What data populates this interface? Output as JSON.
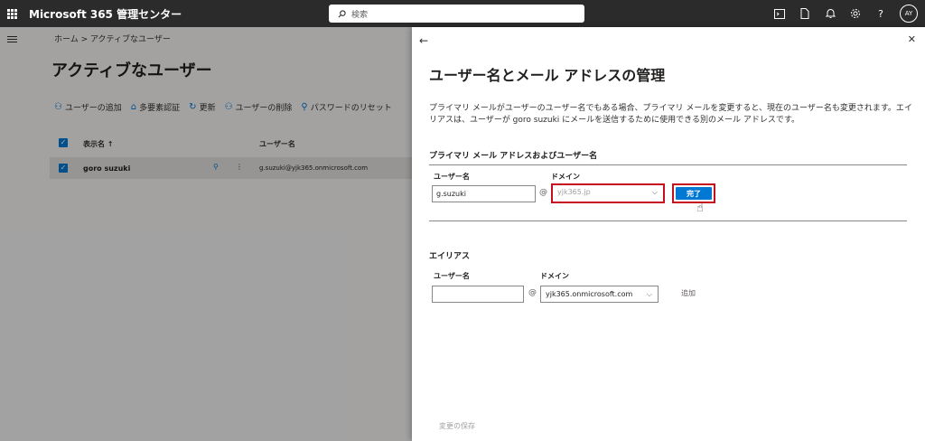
{
  "topbar": {
    "app_title": "Microsoft 365 管理センター",
    "search_placeholder": "検索",
    "avatar_initials": "AY"
  },
  "background": {
    "breadcrumb": "ホーム > アクティブなユーザー",
    "page_title": "アクティブなユーザー",
    "commands": [
      {
        "label": "ユーザーの追加",
        "icon": "person-add-icon"
      },
      {
        "label": "多要素認証",
        "icon": "lock-icon"
      },
      {
        "label": "更新",
        "icon": "refresh-icon"
      },
      {
        "label": "ユーザーの削除",
        "icon": "person-remove-icon"
      },
      {
        "label": "パスワードのリセット",
        "icon": "key-icon"
      }
    ],
    "table": {
      "col_display_name": "表示名 ↑",
      "col_username": "ユーザー名",
      "row_name": "goro suzuki",
      "row_username": "g.suzuki@yjk365.onmicrosoft.com"
    }
  },
  "panel": {
    "title": "ユーザー名とメール アドレスの管理",
    "description": "プライマリ メールがユーザーのユーザー名でもある場合、プライマリ メールを変更すると、現在のユーザー名も変更されます。エイリアスは、ユーザーが goro suzuki にメールを送信するために使用できる別のメール アドレスです。",
    "primary": {
      "section_title": "プライマリ メール アドレスおよびユーザー名",
      "username_label": "ユーザー名",
      "username_value": "g.suzuki",
      "at": "@",
      "domain_label": "ドメイン",
      "domain_value": "yjk365.jp",
      "done_label": "完了"
    },
    "alias": {
      "section_title": "エイリアス",
      "username_label": "ユーザー名",
      "username_value": "",
      "at": "@",
      "domain_label": "ドメイン",
      "domain_value": "yjk365.onmicrosoft.com",
      "add_label": "追加"
    },
    "save_label": "変更の保存"
  },
  "colors": {
    "accent": "#0078d4",
    "highlight": "#c50f1f",
    "topbar": "#2b2b2b"
  }
}
